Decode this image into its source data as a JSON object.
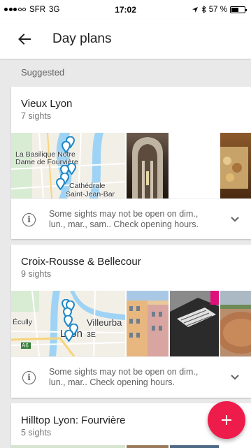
{
  "status": {
    "carrier": "SFR",
    "network": "3G",
    "time": "17:02",
    "battery": "57 %",
    "battery_level": 0.57
  },
  "header": {
    "title": "Day plans"
  },
  "section": {
    "label": "Suggested"
  },
  "cards": [
    {
      "title": "Vieux Lyon",
      "subtitle": "7 sights",
      "map_labels": [
        "La Basilique Notre",
        "Dame de Fourvière",
        "Cathédrale",
        "Saint-Jean-Bar"
      ],
      "notice": "Some sights may not be open on dim., lun., mar., sam.. Check opening hours."
    },
    {
      "title": "Croix-Rousse & Bellecour",
      "subtitle": "9 sights",
      "map_labels": [
        "Écully",
        "Villeurba",
        "Lyon",
        "3E",
        "A6"
      ],
      "notice": "Some sights may not be open on dim., lun., mar.. Check opening hours."
    },
    {
      "title": "Hilltop Lyon: Fourvière",
      "subtitle": "5 sights"
    }
  ],
  "fab": {
    "label": "+"
  },
  "colors": {
    "accent": "#ee1c4a",
    "pin": "#1e88c8",
    "map_water": "#9ed3f5",
    "map_land": "#f2efe7"
  }
}
